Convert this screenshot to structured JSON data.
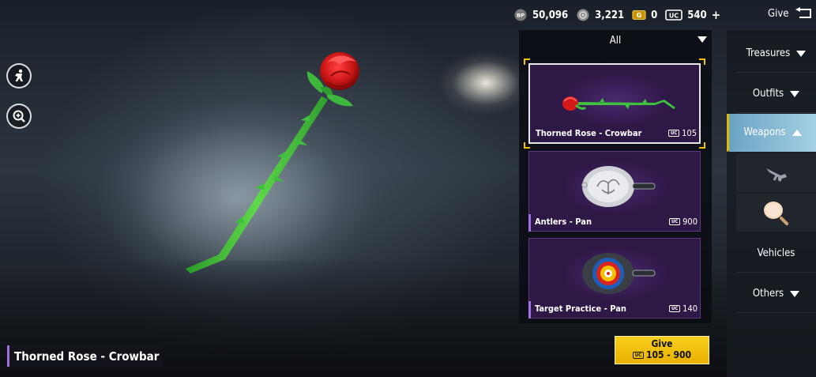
{
  "currencies": [
    {
      "icon": "bp-icon",
      "code": "BP",
      "value": "50,096"
    },
    {
      "icon": "silver-fragment-icon",
      "code": "",
      "value": "3,221"
    },
    {
      "icon": "g-coin-icon",
      "code": "G",
      "value": "0"
    },
    {
      "icon": "uc-icon",
      "code": "UC",
      "value": "540"
    }
  ],
  "header": {
    "give_label": "Give"
  },
  "filter": {
    "selected": "All"
  },
  "items": [
    {
      "name": "Thorned Rose - Crowbar",
      "price": "105",
      "selected": true
    },
    {
      "name": "Antlers - Pan",
      "price": "900",
      "selected": false
    },
    {
      "name": "Target Practice - Pan",
      "price": "140",
      "selected": false
    }
  ],
  "categories": {
    "treasures": "Treasures",
    "outfits": "Outfits",
    "weapons": "Weapons",
    "vehicles": "Vehicles",
    "others": "Others"
  },
  "weapon_subcategories": [
    "gun-icon",
    "pan-icon"
  ],
  "give_button": {
    "label": "Give",
    "price": "105 - 900"
  },
  "selected_item": {
    "title": "Thorned Rose - Crowbar"
  },
  "colors": {
    "accent": "#f2c200",
    "card_bg": "#2e1846",
    "rarity": "#a070e0",
    "active_tab": "#8dbfd9"
  }
}
